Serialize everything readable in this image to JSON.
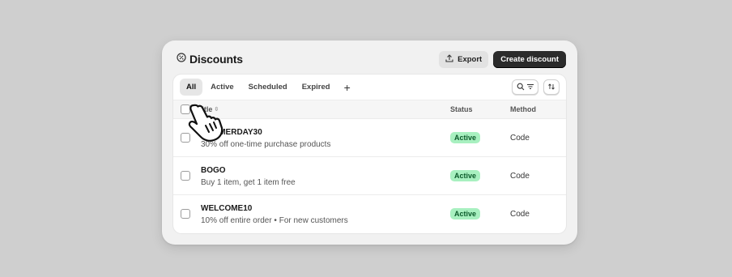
{
  "header": {
    "title": "Discounts",
    "export_label": "Export",
    "create_label": "Create discount"
  },
  "tabs": [
    {
      "label": "All",
      "active": true
    },
    {
      "label": "Active",
      "active": false
    },
    {
      "label": "Scheduled",
      "active": false
    },
    {
      "label": "Expired",
      "active": false
    }
  ],
  "tab_add": "+",
  "columns": {
    "title": "Title",
    "status": "Status",
    "method": "Method"
  },
  "rows": [
    {
      "code": "SUMMERDAY30",
      "description": "30% off one-time purchase products",
      "status": "Active",
      "method": "Code"
    },
    {
      "code": "BOGO",
      "description": "Buy 1 item, get 1 item free",
      "status": "Active",
      "method": "Code"
    },
    {
      "code": "WELCOME10",
      "description": "10% off entire order • For new customers",
      "status": "Active",
      "method": "Code"
    }
  ],
  "colors": {
    "background": "#cfcfcf",
    "card": "#f1f1f1",
    "primary_button": "#2b2b2b",
    "badge_bg": "#a8f0c0",
    "badge_text": "#0b5a2a"
  },
  "icons": {
    "title": "discount-icon",
    "export": "upload-icon",
    "search_filter": "search-filter-icon",
    "sort": "sort-icon",
    "cursor": "hand-pointer-icon"
  }
}
